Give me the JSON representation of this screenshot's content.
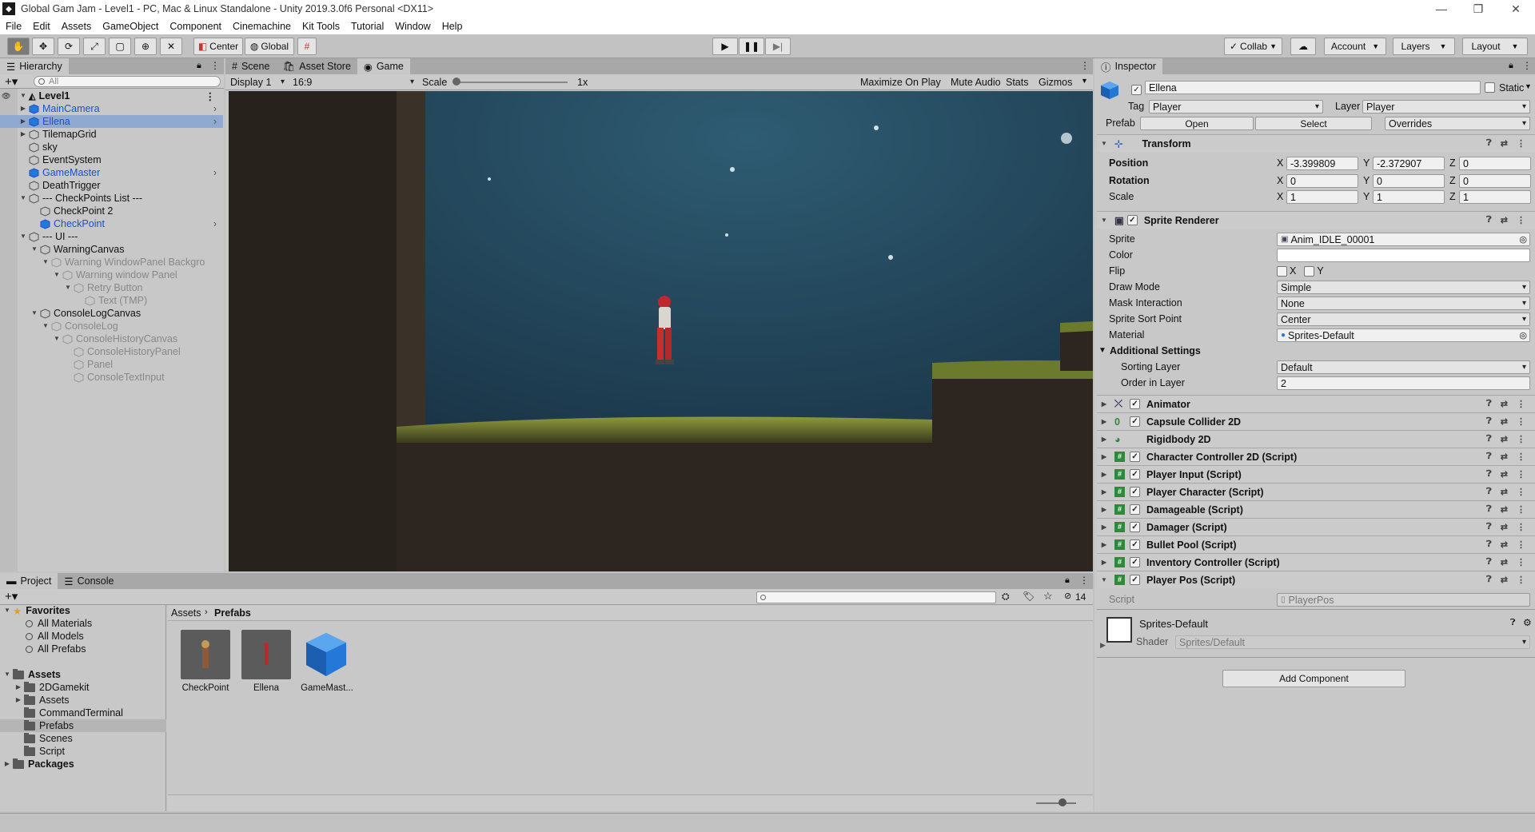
{
  "window": {
    "title": "Global Gam Jam - Level1 - PC, Mac & Linux Standalone - Unity 2019.3.0f6 Personal <DX11>"
  },
  "menu": [
    "File",
    "Edit",
    "Assets",
    "GameObject",
    "Component",
    "Cinemachine",
    "Kit Tools",
    "Tutorial",
    "Window",
    "Help"
  ],
  "toolbar": {
    "pivot": "Center",
    "space": "Global",
    "collab": "Collab",
    "account": "Account",
    "layers": "Layers",
    "layout": "Layout"
  },
  "hierarchy": {
    "tab": "Hierarchy",
    "search_placeholder": "All",
    "scene": "Level1",
    "items": [
      {
        "label": "MainCamera",
        "style": "prefab",
        "indent": 1,
        "arrow": "closed",
        "more": true
      },
      {
        "label": "Ellena",
        "style": "prefab",
        "indent": 1,
        "arrow": "closed",
        "more": true,
        "selected": true
      },
      {
        "label": "TilemapGrid",
        "style": "normal",
        "indent": 1,
        "arrow": "closed"
      },
      {
        "label": "sky",
        "style": "normal",
        "indent": 1
      },
      {
        "label": "EventSystem",
        "style": "normal",
        "indent": 1
      },
      {
        "label": "GameMaster",
        "style": "prefab",
        "indent": 1,
        "more": true
      },
      {
        "label": "DeathTrigger",
        "style": "normal",
        "indent": 1
      },
      {
        "label": "---   CheckPoints List   ---",
        "style": "normal",
        "indent": 1,
        "arrow": "open"
      },
      {
        "label": "CheckPoint 2",
        "style": "normal",
        "indent": 2
      },
      {
        "label": "CheckPoint",
        "style": "prefab",
        "indent": 2,
        "more": true
      },
      {
        "label": "---   UI   ---",
        "style": "normal",
        "indent": 1,
        "arrow": "open"
      },
      {
        "label": "WarningCanvas",
        "style": "normal",
        "indent": 2,
        "arrow": "open"
      },
      {
        "label": "Warning WindowPanel Backgro",
        "style": "disabled",
        "indent": 3,
        "arrow": "open"
      },
      {
        "label": "Warning window Panel",
        "style": "disabled",
        "indent": 4,
        "arrow": "open"
      },
      {
        "label": "Retry Button",
        "style": "disabled",
        "indent": 5,
        "arrow": "open"
      },
      {
        "label": "Text (TMP)",
        "style": "disabled",
        "indent": 6
      },
      {
        "label": "ConsoleLogCanvas",
        "style": "normal",
        "indent": 2,
        "arrow": "open"
      },
      {
        "label": "ConsoleLog",
        "style": "disabled",
        "indent": 3,
        "arrow": "open"
      },
      {
        "label": "ConsoleHistoryCanvas",
        "style": "disabled",
        "indent": 4,
        "arrow": "open"
      },
      {
        "label": "ConsoleHistoryPanel",
        "style": "disabled",
        "indent": 5
      },
      {
        "label": "Panel",
        "style": "disabled",
        "indent": 5
      },
      {
        "label": "ConsoleTextInput",
        "style": "disabled",
        "indent": 5
      }
    ]
  },
  "game": {
    "tabs": [
      "Scene",
      "Asset Store",
      "Game"
    ],
    "display": "Display 1",
    "aspect": "16:9",
    "scale_label": "Scale",
    "scale_value": "1x",
    "options": [
      "Maximize On Play",
      "Mute Audio",
      "Stats",
      "Gizmos"
    ]
  },
  "inspector": {
    "tab": "Inspector",
    "object_name": "Ellena",
    "static_label": "Static",
    "tag_label": "Tag",
    "tag": "Player",
    "layer_label": "Layer",
    "layer": "Player",
    "prefab_label": "Prefab",
    "prefab_buttons": [
      "Open",
      "Select",
      "Overrides"
    ],
    "transform": {
      "title": "Transform",
      "position_label": "Position",
      "position": [
        "-3.399809",
        "-2.372907",
        "0"
      ],
      "rotation_label": "Rotation",
      "rotation": [
        "0",
        "0",
        "0"
      ],
      "scale_label": "Scale",
      "scale": [
        "1",
        "1",
        "1"
      ],
      "axes": [
        "X",
        "Y",
        "Z"
      ]
    },
    "sprite_renderer": {
      "title": "Sprite Renderer",
      "rows": [
        {
          "label": "Sprite",
          "value": "Anim_IDLE_00001"
        },
        {
          "label": "Color",
          "value": ""
        },
        {
          "label": "Flip",
          "value": ""
        },
        {
          "label": "Draw Mode",
          "value": "Simple"
        },
        {
          "label": "Mask Interaction",
          "value": "None"
        },
        {
          "label": "Sprite Sort Point",
          "value": "Center"
        },
        {
          "label": "Material",
          "value": "Sprites-Default"
        }
      ],
      "flip_x": "X",
      "flip_y": "Y",
      "additional": "Additional Settings",
      "sorting_layer_label": "Sorting Layer",
      "sorting_layer": "Default",
      "order_label": "Order in Layer",
      "order": "2"
    },
    "components": [
      {
        "title": "Animator",
        "icon": "animator-icon",
        "check": true
      },
      {
        "title": "Capsule Collider 2D",
        "icon": "collider-icon",
        "check": true
      },
      {
        "title": "Rigidbody 2D",
        "icon": "rigidbody-icon",
        "check": false
      },
      {
        "title": "Character Controller 2D (Script)",
        "icon": "script-icon",
        "check": true
      },
      {
        "title": "Player Input (Script)",
        "icon": "script-icon",
        "check": true
      },
      {
        "title": "Player Character (Script)",
        "icon": "script-icon",
        "check": true
      },
      {
        "title": "Damageable (Script)",
        "icon": "script-icon",
        "check": true
      },
      {
        "title": "Damager (Script)",
        "icon": "script-icon",
        "check": true
      },
      {
        "title": "Bullet Pool (Script)",
        "icon": "script-icon",
        "check": true
      },
      {
        "title": "Inventory Controller (Script)",
        "icon": "script-icon",
        "check": true
      },
      {
        "title": "Player Pos (Script)",
        "icon": "script-icon",
        "check": true
      }
    ],
    "script_label": "Script",
    "script_value": "PlayerPos",
    "material_name": "Sprites-Default",
    "shader_label": "Shader",
    "shader_value": "Sprites/Default",
    "add_component": "Add Component"
  },
  "project": {
    "tabs": [
      "Project",
      "Console"
    ],
    "hidden_count": "14",
    "favorites_label": "Favorites",
    "favorites": [
      "All Materials",
      "All Models",
      "All Prefabs"
    ],
    "assets_label": "Assets",
    "folders": [
      "2DGamekit",
      "Assets",
      "CommandTerminal",
      "Prefabs",
      "Scenes",
      "Script"
    ],
    "packages_label": "Packages",
    "breadcrumb": [
      "Assets",
      "Prefabs"
    ],
    "items": [
      "CheckPoint",
      "Ellena",
      "GameMast..."
    ]
  },
  "colors": {
    "prefab_blue": "#1a4fd1",
    "selection": "#8fa9d1",
    "game_bg": "#1f3a4a"
  }
}
